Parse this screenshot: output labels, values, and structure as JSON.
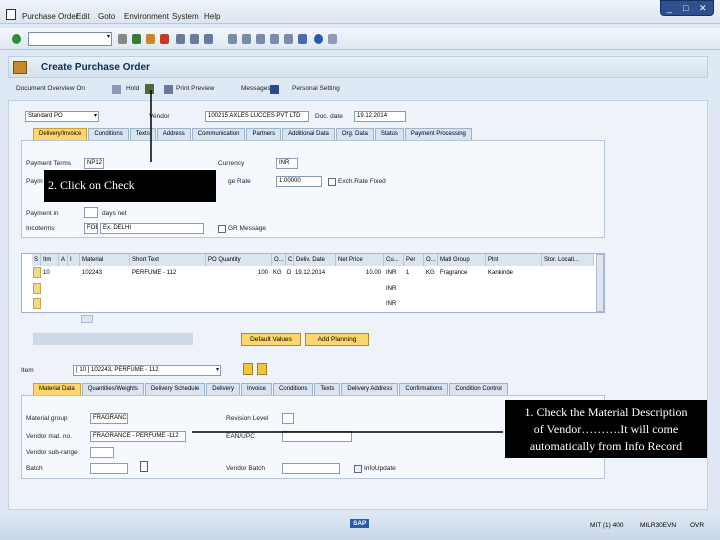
{
  "menu": [
    "Purchase Order",
    "Edit",
    "Goto",
    "Environment",
    "System",
    "Help"
  ],
  "window_controls": [
    "_",
    "□",
    "✕"
  ],
  "command_field": "",
  "title": "Create Purchase Order",
  "app_toolbar": [
    "Document Overview On",
    "Hold",
    "Print Preview",
    "Messages",
    "Personal Setting"
  ],
  "header": {
    "doc_type": "Standard PO",
    "vendor_label": "Vendor",
    "vendor_value": "100215 AXLES LUCCES PVT LTD",
    "doc_date_label": "Doc. date",
    "doc_date_value": "19.12.2014"
  },
  "header_tabs": [
    "Delivery/Invoice",
    "Conditions",
    "Texts",
    "Address",
    "Communication",
    "Partners",
    "Additional Data",
    "Org. Data",
    "Status",
    "Payment Processing"
  ],
  "delivery_invoice": {
    "payment_terms_label": "Payment Terms",
    "payment_terms_value": "NP12",
    "currency_label": "Currency",
    "currency_value": "INR",
    "exch_rate_label": "ge Rate",
    "exch_rate_value": "1.00000",
    "exch_fixed_label": "Exch.Rate Fixed",
    "payment_in_label": "Payment in",
    "days_net_label": "days net",
    "incoterms_label": "Incoterms",
    "incoterms_code": "FOB",
    "incoterms_place": "Ex. DELHI",
    "gr_message_label": "GR Message"
  },
  "items_table": {
    "columns": [
      "S",
      "Itm",
      "A",
      "I",
      "Material",
      "Short Text",
      "PO Quantity",
      "O...",
      "C",
      "Deliv. Date",
      "Net Price",
      "Cu...",
      "Per",
      "O...",
      "Matl Group",
      "Plnt",
      "Stor. Locati..."
    ],
    "rows": [
      [
        "",
        "10",
        "",
        "",
        "102243",
        "PERFUME - 112",
        "100",
        "KG",
        "D",
        "19.12.2014",
        "10.00",
        "INR",
        "1",
        "KG",
        "Fragrance",
        "Kankinde",
        ""
      ],
      [
        "",
        "",
        "",
        "",
        "",
        "",
        "",
        "",
        "",
        "",
        "",
        "INR",
        "",
        "",
        "",
        "",
        ""
      ],
      [
        "",
        "",
        "",
        "",
        "",
        "",
        "",
        "",
        "",
        "",
        "",
        "INR",
        "",
        "",
        "",
        "",
        ""
      ]
    ]
  },
  "buttons": {
    "default_values": "Default Values",
    "add_planning": "Add Planning"
  },
  "item_detail": {
    "item_label": "Item",
    "item_value": "[ 10 ] 102243, PERFUME - 112",
    "tabs": [
      "Material Data",
      "Quantities/Weights",
      "Delivery Schedule",
      "Delivery",
      "Invoice",
      "Conditions",
      "Texts",
      "Delivery Address",
      "Confirmations",
      "Condition Control"
    ],
    "material_group_label": "Material group",
    "material_group_value": "FRAGRANCE",
    "vendor_mat_label": "Vendor mat. no.",
    "vendor_mat_value": "FRAGRANCE - PERFUME -112",
    "vendor_subrange_label": "Vendor sub-range",
    "batch_label": "Batch",
    "revision_label": "Revision Level",
    "ean_label": "EAN/UPC",
    "vendor_batch_label": "Vendor Batch",
    "info_update_label": "InfoUpdate"
  },
  "callouts": {
    "step2": "2. Click on Check",
    "step1_line1": "1. Check the Material Description",
    "step1_line2": "of Vendor……….It will come",
    "step1_line3": "automatically from Info Record"
  },
  "status": {
    "sap": "SAP",
    "system": "MIT (1) 400",
    "server": "MILR30EVN",
    "mode": "OVR"
  }
}
